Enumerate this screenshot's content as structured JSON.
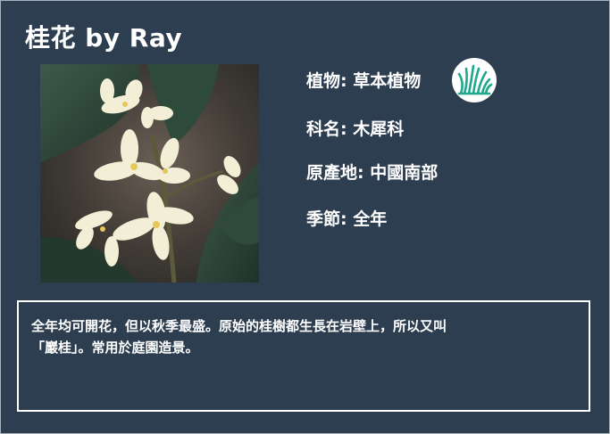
{
  "card": {
    "title": "桂花 by Ray",
    "info": {
      "plant": "植物: 草本植物",
      "family": "科名: 木犀科",
      "origin": "原產地: 中國南部",
      "season": "季節: 全年"
    },
    "plant_type_icon": "grass-icon",
    "description_line1": "全年均可開花，但以秋季最盛。原始的桂樹都生長在岩壁上，所以又叫",
    "description_line2": "「巖桂」。常用於庭園造景。"
  },
  "colors": {
    "background": "#2d3e50",
    "text": "#ffffff",
    "icon_accent": "#1fa88c"
  }
}
